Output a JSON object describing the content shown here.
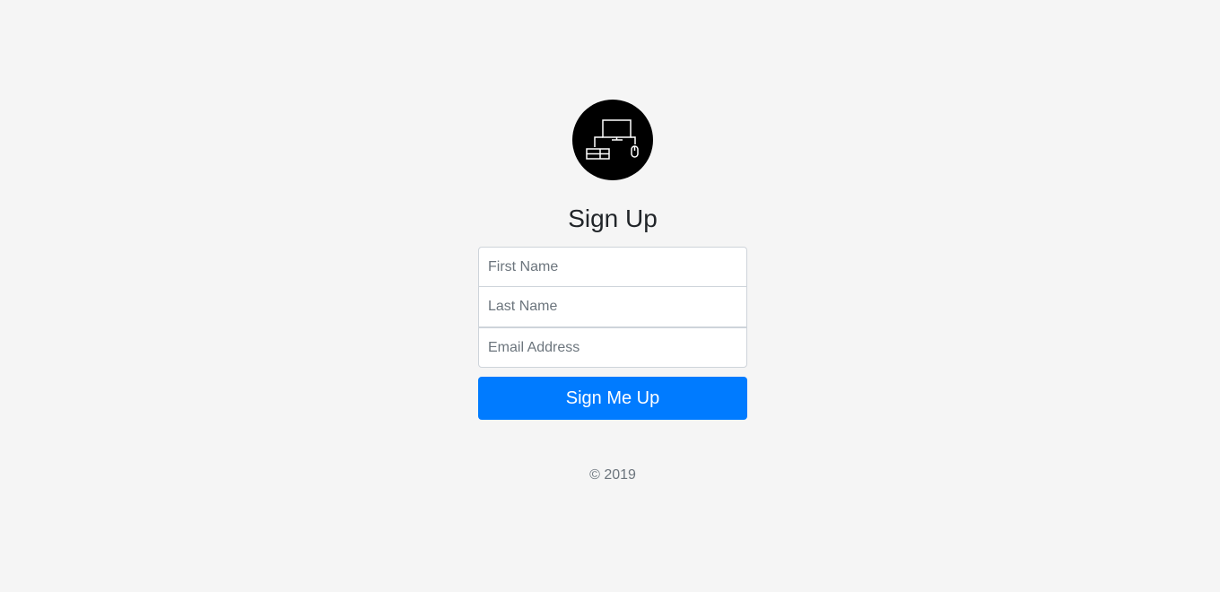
{
  "logo": {
    "icon": "computer-network-icon",
    "background": "#000000"
  },
  "form": {
    "title": "Sign Up",
    "first_name": {
      "placeholder": "First Name",
      "value": ""
    },
    "last_name": {
      "placeholder": "Last Name",
      "value": ""
    },
    "email": {
      "placeholder": "Email Address",
      "value": ""
    },
    "submit_label": "Sign Me Up"
  },
  "footer": {
    "copyright": "© 2019"
  },
  "colors": {
    "page_background": "#f5f5f5",
    "primary": "#007bff",
    "input_border": "#ced4da",
    "muted_text": "#6c757d"
  }
}
